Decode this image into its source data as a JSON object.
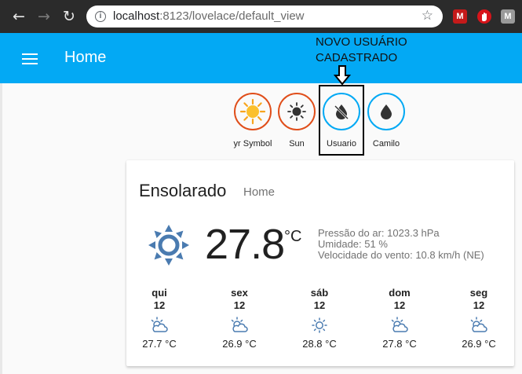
{
  "browser": {
    "url_host": "localhost",
    "url_path": ":8123/lovelace/default_view",
    "extensions": [
      "M",
      "",
      "M"
    ]
  },
  "header": {
    "title": "Home",
    "annotation": "NOVO USUÁRIO\nCADASTRADO"
  },
  "badges": [
    {
      "label": "yr Symbol",
      "icon": "sun-icon",
      "color": "#e04e1a"
    },
    {
      "label": "Sun",
      "icon": "sun-outline-icon",
      "color": "#e04e1a"
    },
    {
      "label": "Usuario",
      "icon": "water-off-icon",
      "color": "#03a9f4"
    },
    {
      "label": "Camilo",
      "icon": "water-icon",
      "color": "#03a9f4"
    }
  ],
  "weather": {
    "condition": "Ensolarado",
    "location": "Home",
    "temperature": "27.8",
    "unit": "°C",
    "attributes": [
      "Pressão do ar: 1023.3 hPa",
      "Umidade: 51 %",
      "Velocidade do vento: 10.8 km/h (NE)"
    ],
    "forecast": [
      {
        "day": "qui",
        "date": "12",
        "icon": "partly-cloudy-icon",
        "temp": "27.7 °C"
      },
      {
        "day": "sex",
        "date": "12",
        "icon": "partly-cloudy-icon",
        "temp": "26.9 °C"
      },
      {
        "day": "sáb",
        "date": "12",
        "icon": "sunny-icon",
        "temp": "28.8 °C"
      },
      {
        "day": "dom",
        "date": "12",
        "icon": "partly-cloudy-icon",
        "temp": "27.8 °C"
      },
      {
        "day": "seg",
        "date": "12",
        "icon": "partly-cloudy-icon",
        "temp": "26.9 °C"
      }
    ]
  }
}
